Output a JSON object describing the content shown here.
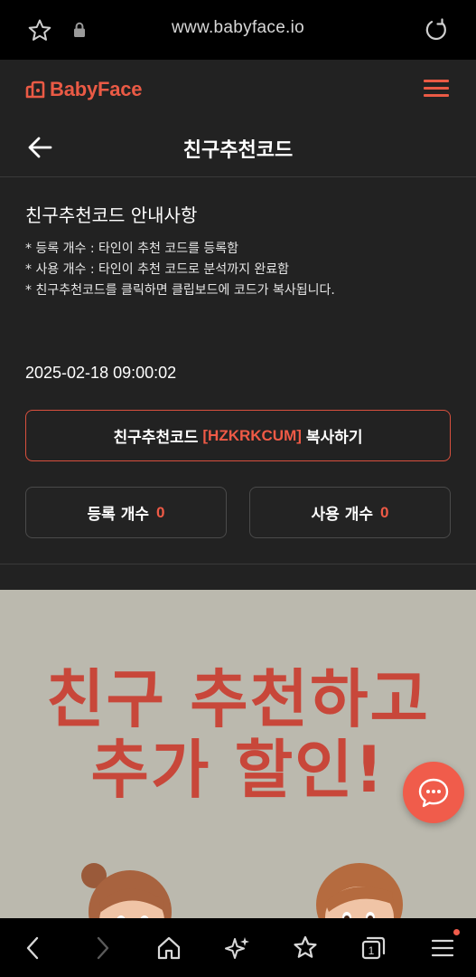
{
  "browser": {
    "url": "www.babyface.io",
    "tab_count": "1"
  },
  "header": {
    "logo_text": "BabyFace",
    "accent_color": "#ea5a45"
  },
  "page": {
    "title": "친구추천코드"
  },
  "guide": {
    "title": "친구추천코드 안내사항",
    "items": [
      "* 등록 개수 : 타인이 추천 코드를 등록함",
      "* 사용 개수 : 타인이 추천 코드로 분석까지 완료함",
      "* 친구추천코드를 클릭하면 클립보드에 코드가 복사됩니다."
    ]
  },
  "timestamp": "2025-02-18 09:00:02",
  "copy_button": {
    "prefix": "친구추천코드",
    "code": "[HZKRKCUM]",
    "suffix": "복사하기"
  },
  "counts": {
    "register_label": "등록 개수",
    "register_value": "0",
    "use_label": "사용 개수",
    "use_value": "0"
  },
  "banner": {
    "line1": "친구 추천하고",
    "line2": "추가 할인!"
  },
  "icons": {
    "top": [
      "star-icon",
      "lock-icon",
      "reload-icon"
    ],
    "bottom": [
      "back-icon",
      "forward-icon",
      "home-icon",
      "sparkle-icon",
      "bookmark-star-icon",
      "tabs-icon",
      "menu-icon"
    ],
    "chat": "chat-bubble-icon"
  }
}
